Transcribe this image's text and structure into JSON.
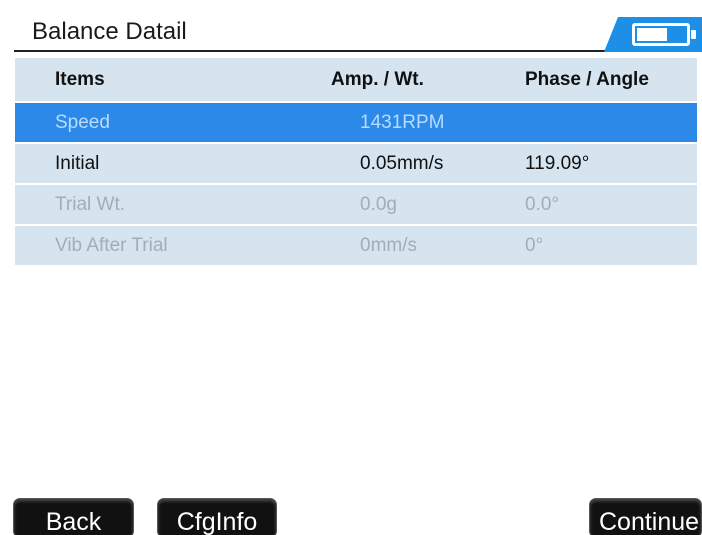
{
  "header": {
    "title": "Balance Datail",
    "status_icon": "battery-icon",
    "accent_color": "#1e8fe6"
  },
  "table": {
    "columns": [
      "Items",
      "Amp. / Wt.",
      "Phase / Angle"
    ],
    "rows": [
      {
        "item": "Speed",
        "amp": "1431RPM",
        "phase": "",
        "state": "selected"
      },
      {
        "item": "Initial",
        "amp": "0.05mm/s",
        "phase": "119.09°",
        "state": "normal"
      },
      {
        "item": "Trial Wt.",
        "amp": "0.0g",
        "phase": "0.0°",
        "state": "dim"
      },
      {
        "item": "Vib After Trial",
        "amp": "0mm/s",
        "phase": "0°",
        "state": "dim"
      }
    ],
    "selected_color": "#2c89e8",
    "row_color": "#d5e4ee"
  },
  "footer": {
    "back_label": "Back",
    "cfginfo_label": "CfgInfo",
    "continue_label": "Continue"
  }
}
